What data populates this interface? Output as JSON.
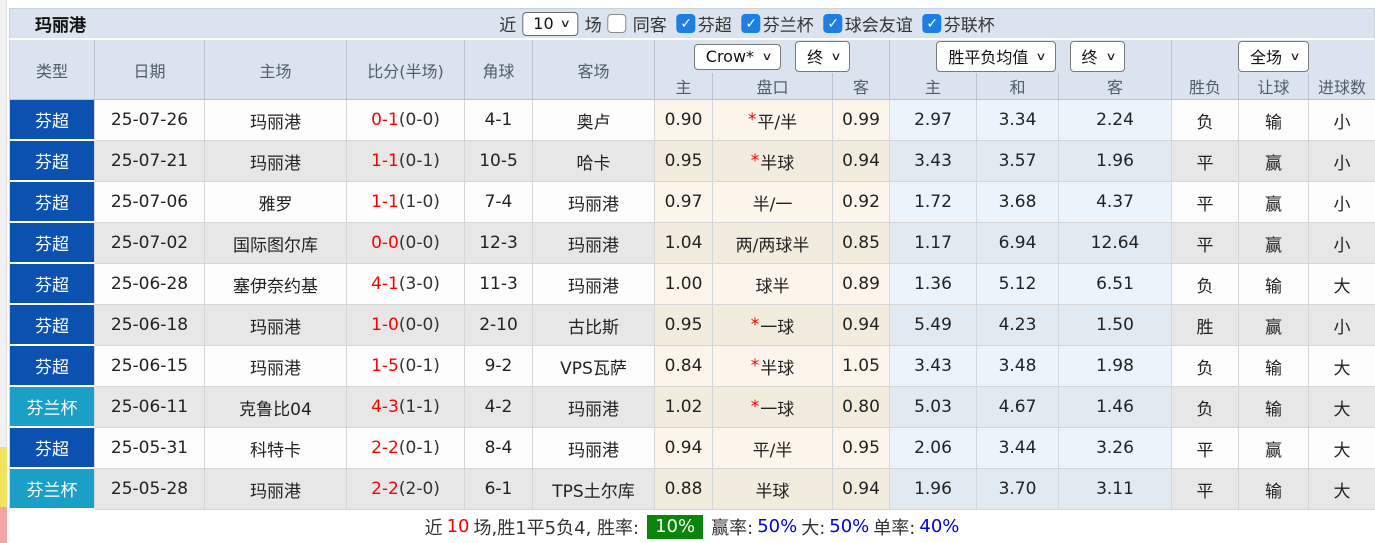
{
  "colors": {
    "league_blue": "#0b52b0",
    "league_cyan": "#1a9fc6",
    "team_green": "#6d9f71",
    "score_red": "#fe0000",
    "result_red": "#f15e5e",
    "result_green": "#456e54",
    "result_blue": "#4343d6",
    "checkbox_blue": "#1d7fe3",
    "rate_badge_green": "#0a840a",
    "header_bg": "#dae3ee"
  },
  "title": "玛丽港",
  "controls": {
    "recent_label": "近",
    "recent_value": "10",
    "matches_label": "场",
    "same_venue": {
      "label": "同客",
      "checked": false
    },
    "check_glyph": "✓",
    "chevron_glyph": "∨",
    "leagues": [
      {
        "label": "芬超",
        "checked": true
      },
      {
        "label": "芬兰杯",
        "checked": true
      },
      {
        "label": "球会友谊",
        "checked": true
      },
      {
        "label": "芬联杯",
        "checked": true
      }
    ]
  },
  "table": {
    "headers": {
      "type": "类型",
      "date": "日期",
      "home": "主场",
      "score": "比分(半场)",
      "corners": "角球",
      "away": "客场",
      "odds_group": {
        "bookmaker": "Crow*",
        "time": "终",
        "cols": [
          "主",
          "盘口",
          "客"
        ]
      },
      "avg_group": {
        "label": "胜平负均值",
        "time": "终",
        "cols": [
          "主",
          "和",
          "客"
        ]
      },
      "result_group": {
        "label": "全场",
        "cols": [
          "胜负",
          "让球",
          "进球数"
        ]
      }
    },
    "rows": [
      {
        "type": "芬超",
        "league": "blue",
        "date": "25-07-26",
        "home": "玛丽港",
        "home_team": true,
        "ft": "0-1",
        "ht": "(0-0)",
        "corners": "4-1",
        "away": "奥卢",
        "away_team": false,
        "o1": "0.90",
        "star": true,
        "handicap": "平/半",
        "o2": "0.99",
        "a1": "2.97",
        "a2": "3.34",
        "a3": "2.24",
        "r1": {
          "t": "负",
          "c": "green"
        },
        "r2": {
          "t": "输",
          "c": "green"
        },
        "r3": {
          "t": "小",
          "c": "green"
        }
      },
      {
        "type": "芬超",
        "league": "blue",
        "date": "25-07-21",
        "home": "玛丽港",
        "home_team": true,
        "ft": "1-1",
        "ht": "(0-1)",
        "corners": "10-5",
        "away": "哈卡",
        "away_team": false,
        "o1": "0.95",
        "star": true,
        "handicap": "半球",
        "o2": "0.94",
        "a1": "3.43",
        "a2": "3.57",
        "a3": "1.96",
        "r1": {
          "t": "平",
          "c": "blue"
        },
        "r2": {
          "t": "赢",
          "c": "red"
        },
        "r3": {
          "t": "小",
          "c": "green"
        }
      },
      {
        "type": "芬超",
        "league": "blue",
        "date": "25-07-06",
        "home": "雅罗",
        "home_team": false,
        "ft": "1-1",
        "ht": "(1-0)",
        "corners": "7-4",
        "away": "玛丽港",
        "away_team": true,
        "o1": "0.97",
        "star": false,
        "handicap": "半/一",
        "o2": "0.92",
        "a1": "1.72",
        "a2": "3.68",
        "a3": "4.37",
        "r1": {
          "t": "平",
          "c": "blue"
        },
        "r2": {
          "t": "赢",
          "c": "red"
        },
        "r3": {
          "t": "小",
          "c": "green"
        }
      },
      {
        "type": "芬超",
        "league": "blue",
        "date": "25-07-02",
        "home": "国际图尔库",
        "home_team": false,
        "ft": "0-0",
        "ht": "(0-0)",
        "corners": "12-3",
        "away": "玛丽港",
        "away_team": true,
        "o1": "1.04",
        "star": false,
        "handicap": "两/两球半",
        "o2": "0.85",
        "a1": "1.17",
        "a2": "6.94",
        "a3": "12.64",
        "r1": {
          "t": "平",
          "c": "blue"
        },
        "r2": {
          "t": "赢",
          "c": "red"
        },
        "r3": {
          "t": "小",
          "c": "green"
        }
      },
      {
        "type": "芬超",
        "league": "blue",
        "date": "25-06-28",
        "home": "塞伊奈约基",
        "home_team": false,
        "ft": "4-1",
        "ht": "(3-0)",
        "corners": "11-3",
        "away": "玛丽港",
        "away_team": true,
        "o1": "1.00",
        "star": false,
        "handicap": "球半",
        "o2": "0.89",
        "a1": "1.36",
        "a2": "5.12",
        "a3": "6.51",
        "r1": {
          "t": "负",
          "c": "green"
        },
        "r2": {
          "t": "输",
          "c": "green"
        },
        "r3": {
          "t": "大",
          "c": "red"
        }
      },
      {
        "type": "芬超",
        "league": "blue",
        "date": "25-06-18",
        "home": "玛丽港",
        "home_team": true,
        "ft": "1-0",
        "ht": "(0-0)",
        "corners": "2-10",
        "away": "古比斯",
        "away_team": false,
        "o1": "0.95",
        "star": true,
        "handicap": "一球",
        "o2": "0.94",
        "a1": "5.49",
        "a2": "4.23",
        "a3": "1.50",
        "r1": {
          "t": "胜",
          "c": "red"
        },
        "r2": {
          "t": "赢",
          "c": "red"
        },
        "r3": {
          "t": "小",
          "c": "green"
        }
      },
      {
        "type": "芬超",
        "league": "blue",
        "date": "25-06-15",
        "home": "玛丽港",
        "home_team": true,
        "ft": "1-5",
        "ht": "(0-1)",
        "corners": "9-2",
        "away": "VPS瓦萨",
        "away_team": false,
        "o1": "0.84",
        "star": true,
        "handicap": "半球",
        "o2": "1.05",
        "a1": "3.43",
        "a2": "3.48",
        "a3": "1.98",
        "r1": {
          "t": "负",
          "c": "green"
        },
        "r2": {
          "t": "输",
          "c": "green"
        },
        "r3": {
          "t": "大",
          "c": "red"
        }
      },
      {
        "type": "芬兰杯",
        "league": "cyan",
        "date": "25-06-11",
        "home": "克鲁比04",
        "home_team": false,
        "ft": "4-3",
        "ht": "(1-1)",
        "corners": "4-2",
        "away": "玛丽港",
        "away_team": true,
        "o1": "1.02",
        "star": true,
        "handicap": "一球",
        "o2": "0.80",
        "a1": "5.03",
        "a2": "4.67",
        "a3": "1.46",
        "r1": {
          "t": "负",
          "c": "green"
        },
        "r2": {
          "t": "输",
          "c": "green"
        },
        "r3": {
          "t": "大",
          "c": "red"
        }
      },
      {
        "type": "芬超",
        "league": "blue",
        "date": "25-05-31",
        "home": "科特卡",
        "home_team": false,
        "ft": "2-2",
        "ht": "(0-1)",
        "corners": "8-4",
        "away": "玛丽港",
        "away_team": true,
        "o1": "0.94",
        "star": false,
        "handicap": "平/半",
        "o2": "0.95",
        "a1": "2.06",
        "a2": "3.44",
        "a3": "3.26",
        "r1": {
          "t": "平",
          "c": "blue"
        },
        "r2": {
          "t": "赢",
          "c": "red"
        },
        "r3": {
          "t": "大",
          "c": "red"
        }
      },
      {
        "type": "芬兰杯",
        "league": "cyan",
        "date": "25-05-28",
        "home": "玛丽港",
        "home_team": true,
        "ft": "2-2",
        "ht": "(2-0)",
        "corners": "6-1",
        "away": "TPS土尔库",
        "away_team": false,
        "o1": "0.88",
        "star": false,
        "handicap": "半球",
        "o2": "0.94",
        "a1": "1.96",
        "a2": "3.70",
        "a3": "3.11",
        "r1": {
          "t": "平",
          "c": "blue"
        },
        "r2": {
          "t": "输",
          "c": "green"
        },
        "r3": {
          "t": "大",
          "c": "red"
        }
      }
    ]
  },
  "summary": {
    "prefix": "近",
    "count": "10",
    "record": "场,胜1平5负4, 胜率:",
    "win_rate": "10%",
    "stat1_label": "赢率:",
    "stat1_value": "50%",
    "stat2_label": "大:",
    "stat2_value": "50%",
    "stat3_label": "单率:",
    "stat3_value": "40%"
  }
}
